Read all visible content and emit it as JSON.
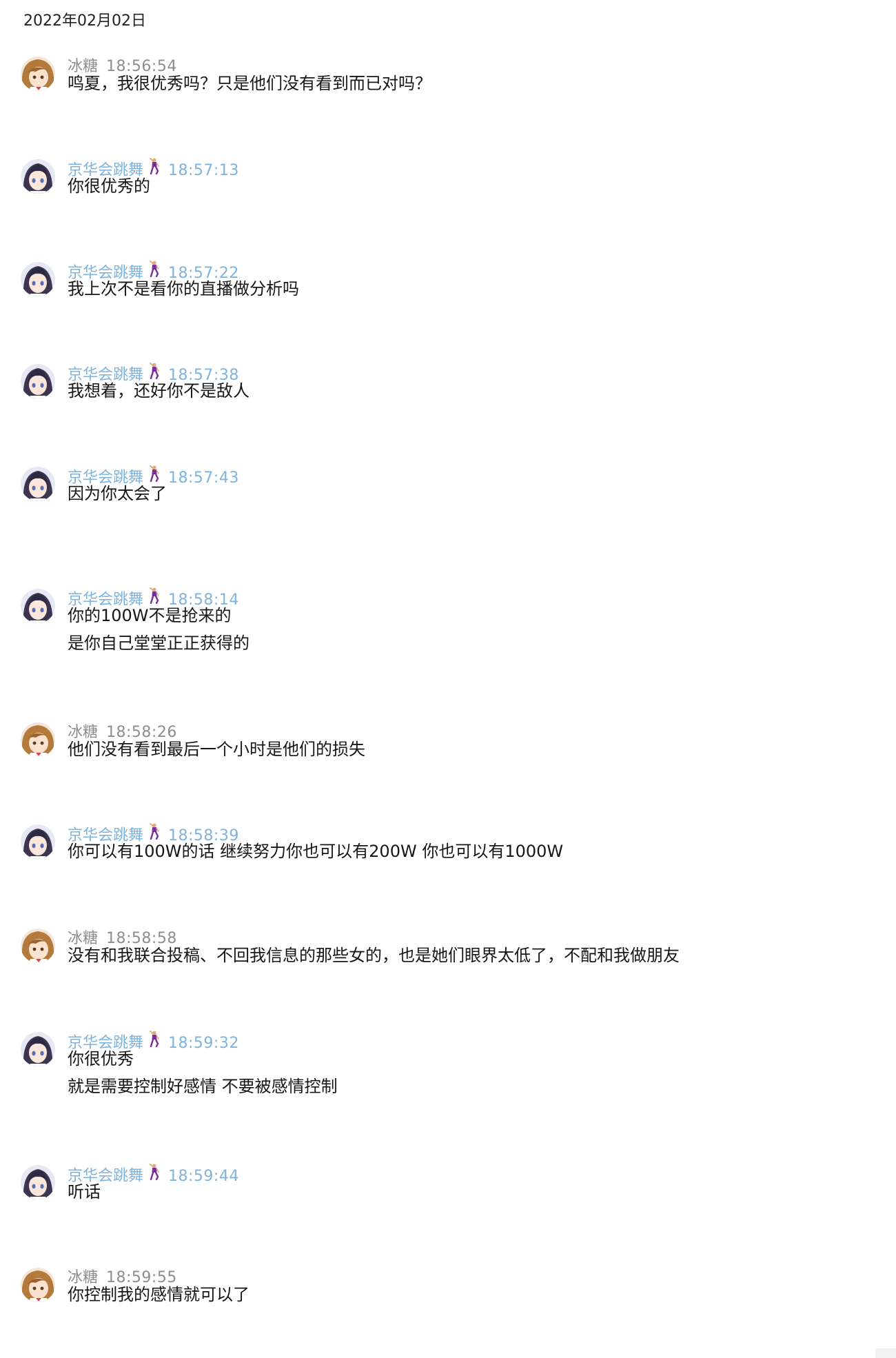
{
  "date": "2022年02月02日",
  "senders": {
    "bingtang": {
      "name": "冰糖",
      "color": "#8d8d8d",
      "avatar": "bingtang-avatar"
    },
    "jinghua": {
      "name": "京华会跳舞",
      "color": "#7fb3dc",
      "avatar": "jinghua-avatar",
      "badge": "dancer-emoji"
    }
  },
  "messages": [
    {
      "sender": "冰糖",
      "time": "18:56:54",
      "lines": [
        "鸣夏，我很优秀吗？只是他们没有看到而已对吗？"
      ]
    },
    {
      "sender": "京华会跳舞",
      "time": "18:57:13",
      "lines": [
        "你很优秀的"
      ]
    },
    {
      "sender": "京华会跳舞",
      "time": "18:57:22",
      "lines": [
        "我上次不是看你的直播做分析吗"
      ]
    },
    {
      "sender": "京华会跳舞",
      "time": "18:57:38",
      "lines": [
        "我想着，还好你不是敌人"
      ]
    },
    {
      "sender": "京华会跳舞",
      "time": "18:57:43",
      "lines": [
        "因为你太会了"
      ]
    },
    {
      "sender": "京华会跳舞",
      "time": "18:58:14",
      "lines": [
        "你的100W不是抢来的",
        "是你自己堂堂正正获得的"
      ]
    },
    {
      "sender": "冰糖",
      "time": "18:58:26",
      "lines": [
        "他们没有看到最后一个小时是他们的损失"
      ]
    },
    {
      "sender": "京华会跳舞",
      "time": "18:58:39",
      "lines": [
        "你可以有100W的话 继续努力你也可以有200W 你也可以有1000W"
      ]
    },
    {
      "sender": "冰糖",
      "time": "18:58:58",
      "lines": [
        "没有和我联合投稿、不回我信息的那些女的，也是她们眼界太低了，不配和我做朋友"
      ]
    },
    {
      "sender": "京华会跳舞",
      "time": "18:59:32",
      "lines": [
        "你很优秀",
        "就是需要控制好感情 不要被感情控制"
      ]
    },
    {
      "sender": "京华会跳舞",
      "time": "18:59:44",
      "lines": [
        "听话"
      ]
    },
    {
      "sender": "冰糖",
      "time": "18:59:55",
      "lines": [
        "你控制我的感情就可以了"
      ]
    }
  ]
}
